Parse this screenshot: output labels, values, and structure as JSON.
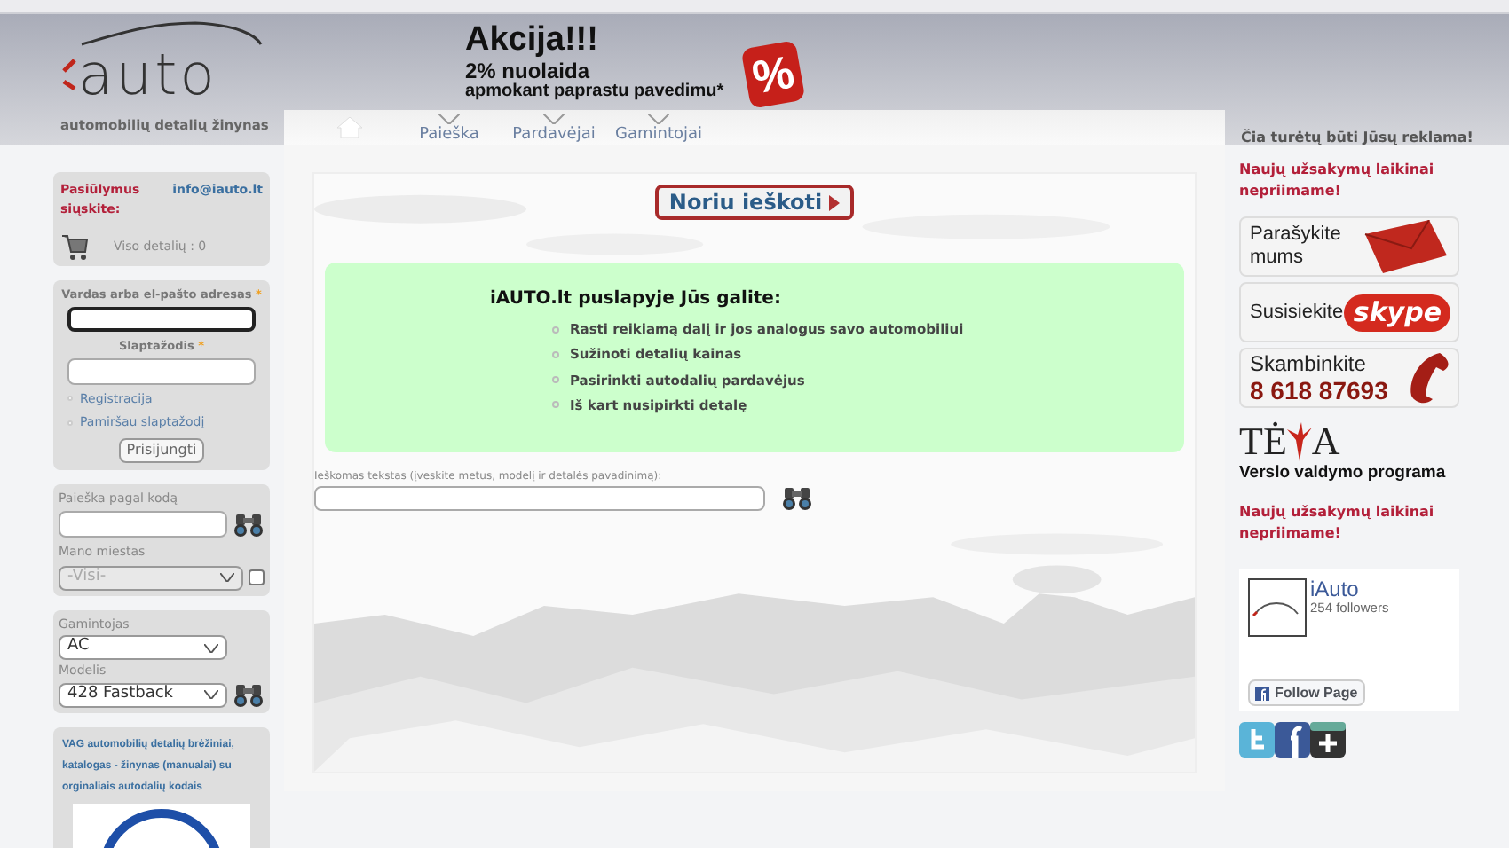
{
  "header": {
    "logo_text": "auto",
    "tagline": "automobilių detalių žinynas",
    "promo": {
      "title": "Akcija!!!",
      "line1": "2% nuolaida",
      "line2": "apmokant paprastu pavedimu*",
      "tag": "%"
    },
    "ad_text": "Čia turėtų būti Jūsų reklama!"
  },
  "nav": {
    "items": [
      {
        "label": "Paieška"
      },
      {
        "label": "Pardavėjai"
      },
      {
        "label": "Gamintojai"
      }
    ]
  },
  "sidebar": {
    "contact": {
      "label": "Pasiūlymus siųskite:",
      "email": "info@iauto.lt",
      "cart_text": "Viso detalių : 0"
    },
    "login": {
      "user_label": "Vardas arba el-pašto adresas",
      "password_label": "Slaptažodis",
      "required": "*",
      "links": [
        "Registracija",
        "Pamiršau slaptažodį"
      ],
      "button": "Prisijungti"
    },
    "code_search": {
      "label": "Paieška pagal kodą",
      "city_label": "Mano miestas",
      "city_value": "-Visi-",
      "city_checked": false
    },
    "maker_search": {
      "maker_label": "Gamintojas",
      "maker_value": "AC",
      "model_label": "Modelis",
      "model_value": "428 Fastback"
    },
    "vag": {
      "text": "VAG automobilių detalių brėžiniai, katalogas - žinynas (manualai) su orginaliais autodalių kodais"
    }
  },
  "main": {
    "search_button": "Noriu ieškoti",
    "info": {
      "title": "iAUTO.lt puslapyje Jūs galite:",
      "items": [
        "Rasti reikiamą dalį ir jos analogus savo automobiliui",
        "Sužinoti detalių kainas",
        "Pasirinkti autodalių pardavėjus",
        "Iš kart nusipirkti detalę"
      ]
    },
    "search_label": "Ieškomas tekstas (įveskite metus, modelį ir detalės pavadinimą):"
  },
  "right": {
    "notice": "Naujų užsakymų laikinai nepriimame!",
    "contacts": [
      {
        "kind": "mail",
        "label": "Parašykite mums"
      },
      {
        "kind": "skype",
        "label": "Susisiekite",
        "brand": "skype"
      },
      {
        "kind": "phone",
        "label": "Skambinkite",
        "number": "8 618 87693"
      }
    ],
    "tea": {
      "letters": [
        "TĖ",
        "A"
      ],
      "caption": "Verslo valdymo programa"
    },
    "notice2": "Naujų užsakymų laikinai nepriimame!",
    "facebook": {
      "name": "iAuto",
      "followers": "254 followers",
      "button": "Follow Page"
    }
  }
}
